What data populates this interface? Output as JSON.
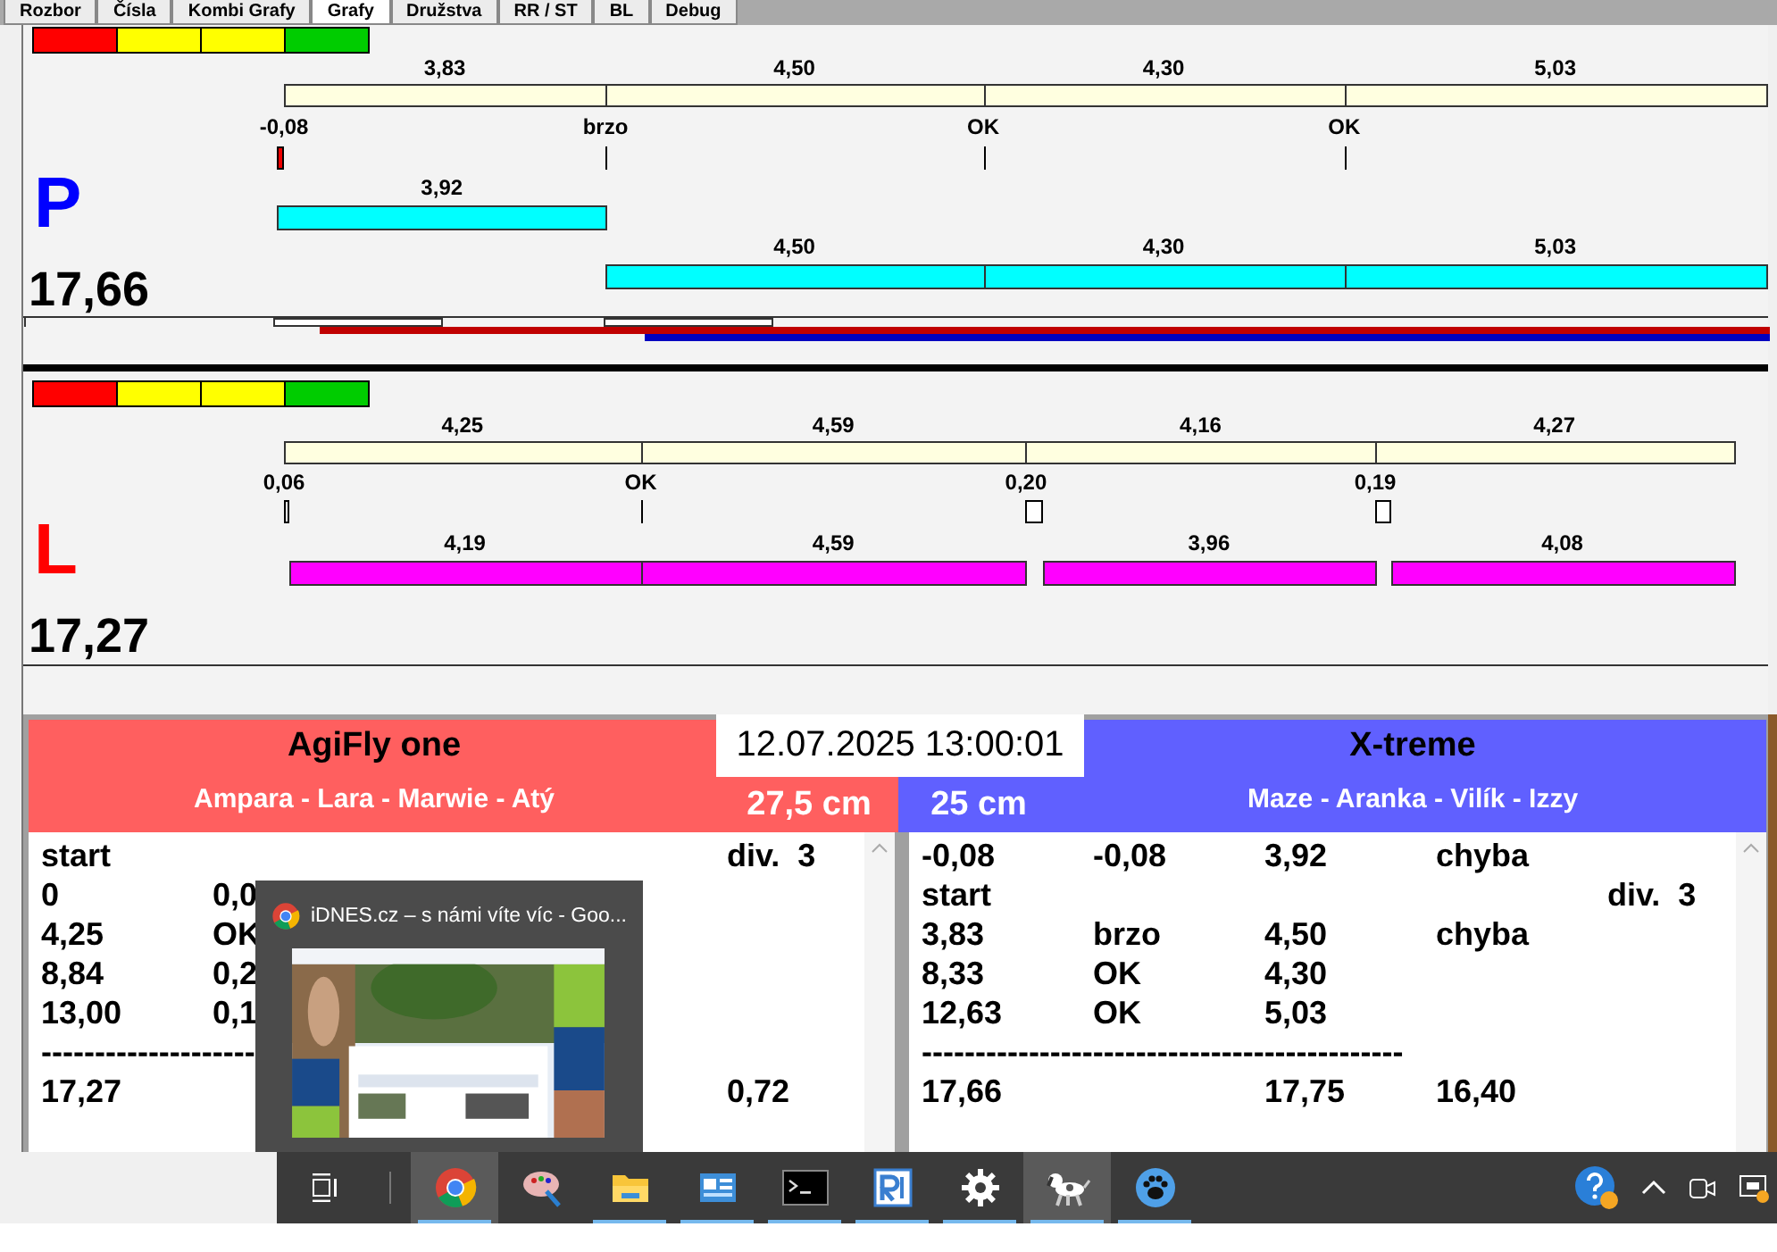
{
  "tabs": [
    {
      "label": "Rozbor",
      "selected": false
    },
    {
      "label": "Čísla",
      "selected": false
    },
    {
      "label": "Kombi Grafy",
      "selected": false
    },
    {
      "label": "Grafy",
      "selected": true
    },
    {
      "label": "Družstva",
      "selected": false
    },
    {
      "label": "RR / ST",
      "selected": false
    },
    {
      "label": "BL",
      "selected": false
    },
    {
      "label": "Debug",
      "selected": false
    }
  ],
  "panels": [
    {
      "letter": "P",
      "color": "#0000ff",
      "total": "17,66",
      "ruler": [
        "3,83",
        "4,50",
        "4,30",
        "5,03"
      ],
      "markers": [
        "-0,08",
        "brzo",
        "OK",
        "OK"
      ],
      "runs": [
        "3,92",
        "4,50",
        "4,30",
        "5,03"
      ]
    },
    {
      "letter": "L",
      "color": "#ff0000",
      "total": "17,27",
      "ruler": [
        "4,25",
        "4,59",
        "4,16",
        "4,27"
      ],
      "markers": [
        "0,06",
        "OK",
        "0,20",
        "0,19"
      ],
      "runs": [
        "4,19",
        "4,59",
        "3,96",
        "4,08"
      ]
    }
  ],
  "timestamp": "12.07.2025 13:00:01",
  "teams": [
    {
      "name": "AgiFly one",
      "members": "Ampara - Lara - Marwie - Atý",
      "height": "27,5 cm",
      "color": "#ff5f5f",
      "rows": [
        {
          "col_1": "start",
          "col_5": "div.  3"
        },
        {
          "col_1": "0",
          "col_2": "0,0"
        },
        {
          "col_1": "4,25",
          "col_2": "OK"
        },
        {
          "col_1": "8,84",
          "col_2": "0,2"
        },
        {
          "col_1": "13,00",
          "col_2": "0,1"
        },
        {
          "kind": "rule",
          "text": "--------------------"
        },
        {
          "col_1": "17,27",
          "col_5": "0,72"
        }
      ]
    },
    {
      "name": "X-treme",
      "members": "Maze - Aranka - Vilík - Izzy",
      "height": "25 cm",
      "color": "#6060ff",
      "rows": [
        {
          "col_1": "-0,08",
          "col_2": "-0,08",
          "col_3": "3,92",
          "col_4": "chyba"
        },
        {
          "col_1": "start",
          "col_5": "div.  3"
        },
        {
          "col_1": "3,83",
          "col_2": "brzo",
          "col_3": "4,50",
          "col_4": "chyba"
        },
        {
          "col_1": "8,33",
          "col_2": "OK",
          "col_3": "4,30"
        },
        {
          "col_1": "12,63",
          "col_2": "OK",
          "col_3": "5,03"
        },
        {
          "kind": "rule",
          "text": "---------------------------------------------"
        },
        {
          "col_1": "17,66",
          "col_3": "17,75",
          "col_4": "16,40"
        }
      ]
    }
  ],
  "preview": {
    "title": "iDNES.cz – s námi víte víc - Goo...",
    "kind": "picture"
  },
  "taskbar": {
    "apps": [
      {
        "kind": "browser",
        "open": true,
        "selected": true
      },
      {
        "kind": "palette",
        "open": false,
        "selected": false
      },
      {
        "kind": "folder",
        "open": true,
        "selected": false
      },
      {
        "kind": "window",
        "open": true,
        "selected": false
      },
      {
        "kind": "terminal",
        "open": true,
        "selected": false
      },
      {
        "kind": "remote",
        "open": true,
        "selected": false
      },
      {
        "kind": "gear",
        "open": true,
        "selected": false
      },
      {
        "kind": "dog",
        "open": true,
        "selected": true
      },
      {
        "kind": "paw",
        "open": true,
        "selected": false
      }
    ]
  }
}
